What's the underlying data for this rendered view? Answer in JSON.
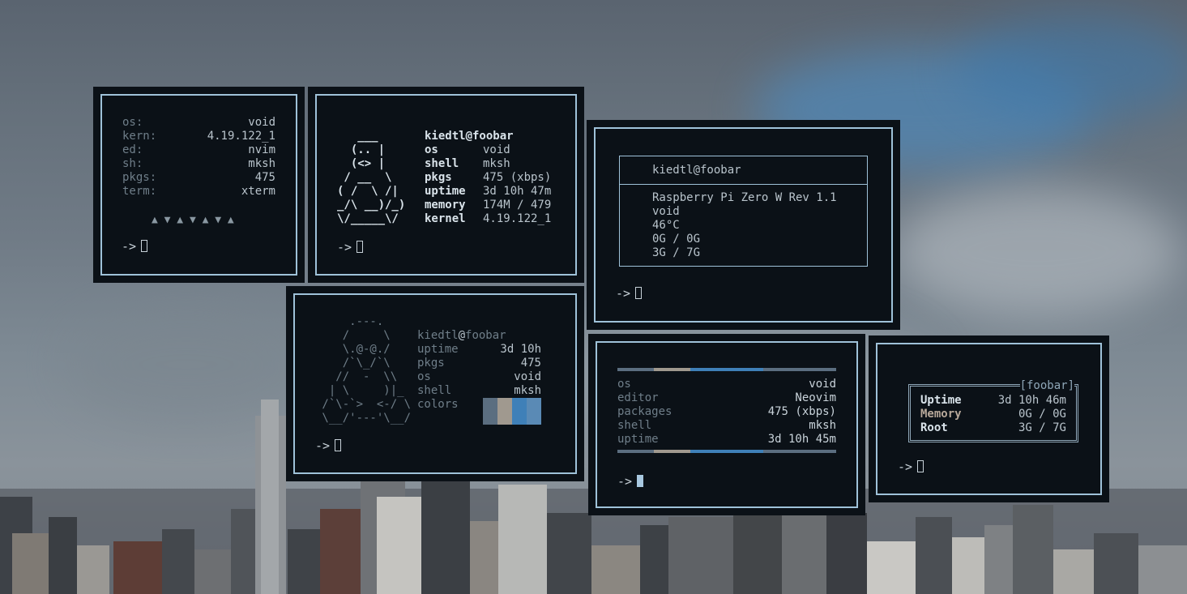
{
  "colors": {
    "accent": "#9fc2d9",
    "bg": "#0b1117",
    "text": "#b9c4cc",
    "dim": "#6f7e89"
  },
  "prompt": "->",
  "w1": {
    "rows": [
      {
        "k": "os:",
        "v": "void"
      },
      {
        "k": "kern:",
        "v": "4.19.122_1"
      },
      {
        "k": "ed:",
        "v": "nvim"
      },
      {
        "k": "sh:",
        "v": "mksh"
      },
      {
        "k": "pkgs:",
        "v": "475"
      },
      {
        "k": "term:",
        "v": "xterm"
      }
    ],
    "triangles": "▲ ▼ ▲ ▼ ▲ ▼ ▲"
  },
  "w2": {
    "ascii": "   ___\n  (.. |\n  (<> |\n / __  \\\n( /  \\ /|\n_/\\ __)/_)\n\\/_____\\/",
    "user": "kiedtl@foobar",
    "rows": [
      {
        "k": "os",
        "v": "void"
      },
      {
        "k": "shell",
        "v": "mksh"
      },
      {
        "k": "pkgs",
        "v": "475 (xbps)"
      },
      {
        "k": "uptime",
        "v": "3d 10h 47m"
      },
      {
        "k": "memory",
        "v": "174M / 479"
      },
      {
        "k": "kernel",
        "v": "4.19.122_1"
      }
    ]
  },
  "w3": {
    "user": "kiedtl@foobar",
    "lines": [
      "Raspberry Pi Zero W Rev 1.1",
      "void",
      "46°C",
      "0G / 0G",
      "3G / 7G"
    ]
  },
  "w4": {
    "ascii": "     .---.\n    /     \\\n    \\.@-@./\n    /`\\_/`\\\n   //  -  \\\\\n  | \\     )|_\n /`\\-`>  <-/ \\\n \\__/'---'\\__/",
    "user_name": "kiedtl",
    "user_at": "@",
    "user_host": "foobar",
    "rows": [
      {
        "k": "uptime",
        "v": "3d 10h"
      },
      {
        "k": "pkgs",
        "v": "475"
      },
      {
        "k": "os",
        "v": "void"
      },
      {
        "k": "shell",
        "v": "mksh"
      }
    ],
    "colors_label": "colors",
    "swatches": [
      "#5b6e80",
      "#a0998f",
      "#3f80b8",
      "#5a8ab5"
    ]
  },
  "w5": {
    "rows": [
      {
        "k": "os",
        "v": "void"
      },
      {
        "k": "editor",
        "v": "Neovim"
      },
      {
        "k": "packages",
        "v": "475 (xbps)"
      },
      {
        "k": "shell",
        "v": "mksh"
      },
      {
        "k": "uptime",
        "v": "3d 10h 45m"
      }
    ]
  },
  "w6": {
    "title": "[foobar]",
    "rows": [
      {
        "k": "Uptime",
        "v": "3d 10h 46m"
      },
      {
        "k": "Memory",
        "v": "0G / 0G"
      },
      {
        "k": "Root",
        "v": "3G / 7G"
      }
    ]
  }
}
